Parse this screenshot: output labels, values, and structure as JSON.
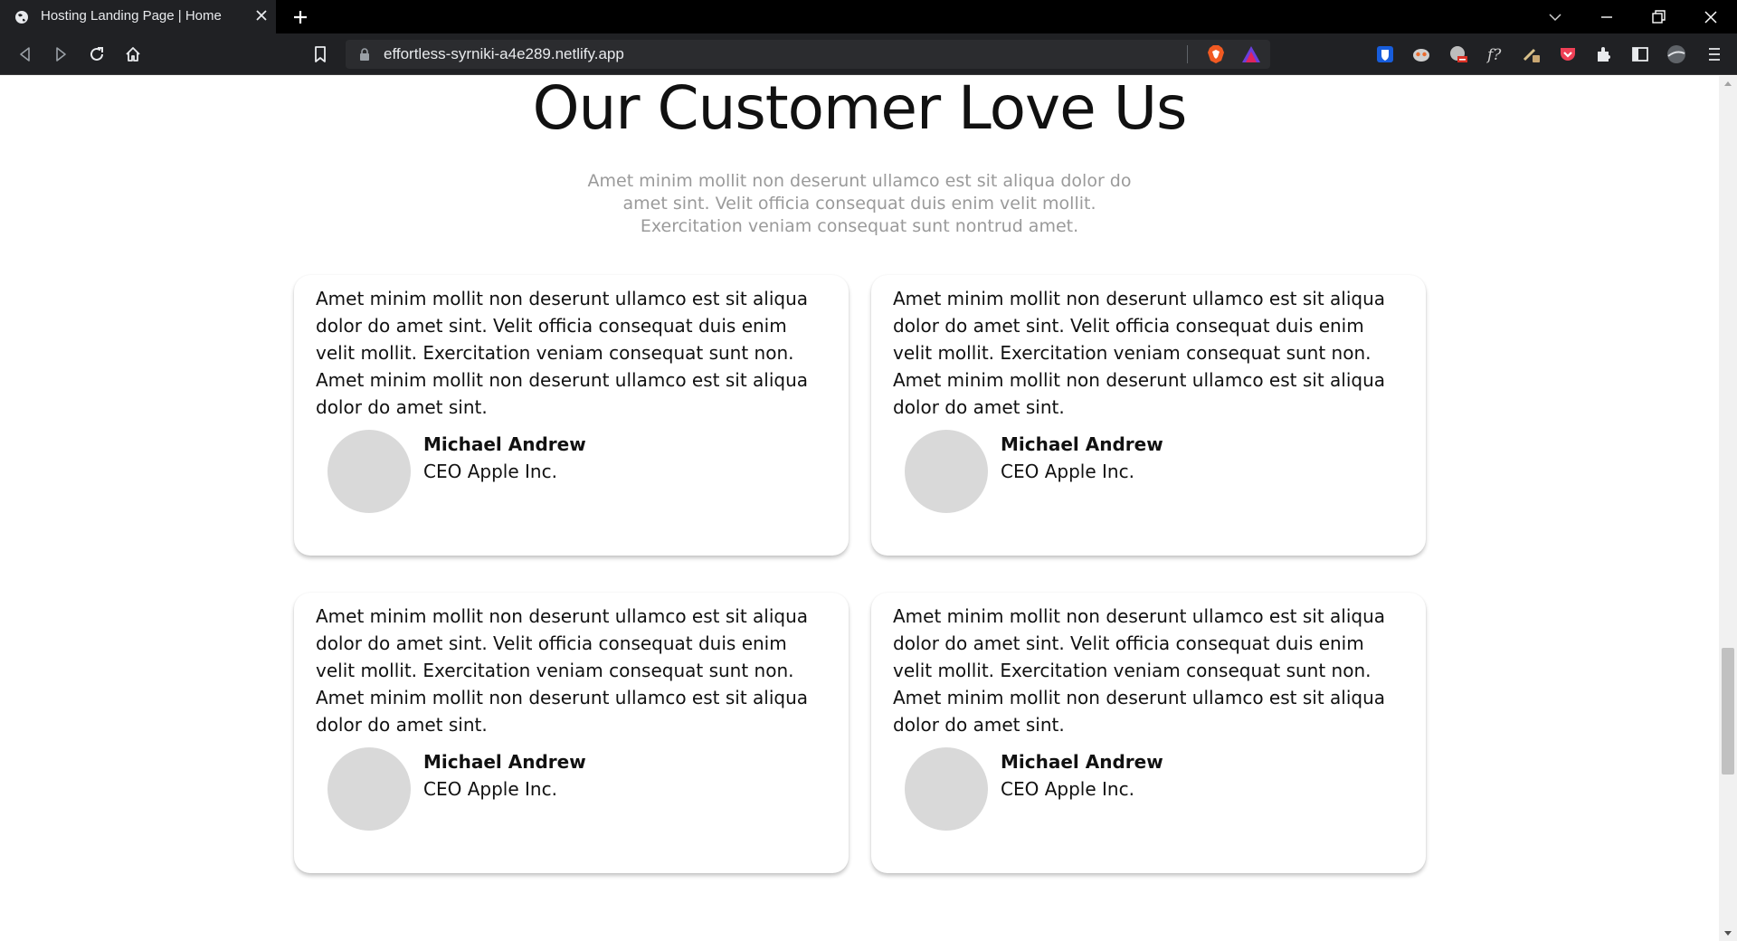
{
  "browser": {
    "tab_title": "Hosting Landing Page | Home",
    "url": "effortless-syrniki-a4e289.netlify.app"
  },
  "section": {
    "heading": "Our Customer Love Us",
    "subheading": "Amet minim mollit non deserunt ullamco est sit aliqua dolor do amet sint. Velit officia consequat duis enim velit mollit. Exercitation veniam consequat sunt nontrud amet."
  },
  "testimonials": [
    {
      "text": "Amet minim mollit non deserunt ullamco est sit aliqua dolor do amet sint. Velit officia consequat duis enim velit mollit. Exercitation veniam consequat sunt non. Amet minim mollit non deserunt ullamco est sit aliqua dolor do amet sint.",
      "name": "Michael Andrew",
      "role": "CEO Apple Inc."
    },
    {
      "text": "Amet minim mollit non deserunt ullamco est sit aliqua dolor do amet sint. Velit officia consequat duis enim velit mollit. Exercitation veniam consequat sunt non. Amet minim mollit non deserunt ullamco est sit aliqua dolor do amet sint.",
      "name": "Michael Andrew",
      "role": "CEO Apple Inc."
    },
    {
      "text": "Amet minim mollit non deserunt ullamco est sit aliqua dolor do amet sint. Velit officia consequat duis enim velit mollit. Exercitation veniam consequat sunt non. Amet minim mollit non deserunt ullamco est sit aliqua dolor do amet sint.",
      "name": "Michael Andrew",
      "role": "CEO Apple Inc."
    },
    {
      "text": "Amet minim mollit non deserunt ullamco est sit aliqua dolor do amet sint. Velit officia consequat duis enim velit mollit. Exercitation veniam consequat sunt non. Amet minim mollit non deserunt ullamco est sit aliqua dolor do amet sint.",
      "name": "Michael Andrew",
      "role": "CEO Apple Inc."
    }
  ],
  "icons": {
    "tab": [
      "globe-icon",
      "close-icon",
      "plus-icon"
    ],
    "window": [
      "chevron-down-icon",
      "minimize-icon",
      "restore-icon",
      "close-window-icon"
    ],
    "nav": [
      "back-icon",
      "forward-icon",
      "reload-icon",
      "home-icon",
      "bookmark-icon",
      "lock-icon",
      "brave-shield-icon",
      "brave-rewards-icon"
    ],
    "extensions": [
      "bitwarden-icon",
      "privacy-badger-icon",
      "cookie-icon",
      "font-icon",
      "eyedropper-icon",
      "pocket-icon",
      "extensions-icon",
      "sidebar-icon",
      "profile-icon",
      "menu-icon"
    ]
  }
}
